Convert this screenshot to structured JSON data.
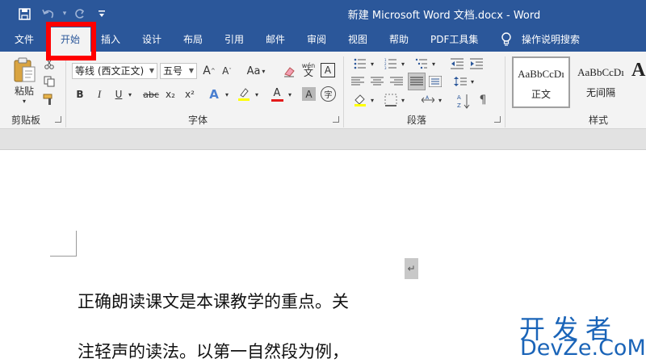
{
  "window": {
    "title": "新建 Microsoft Word 文档.docx  -  Word"
  },
  "quick_access": {
    "save_icon": "save-icon",
    "undo_icon": "undo-icon",
    "redo_icon": "redo-icon",
    "customize_icon": "customize-quick-access-icon"
  },
  "menu": {
    "tabs": [
      {
        "label": "文件"
      },
      {
        "label": "开始"
      },
      {
        "label": "插入"
      },
      {
        "label": "设计"
      },
      {
        "label": "布局"
      },
      {
        "label": "引用"
      },
      {
        "label": "邮件"
      },
      {
        "label": "审阅"
      },
      {
        "label": "视图"
      },
      {
        "label": "帮助"
      },
      {
        "label": "PDF工具集"
      },
      {
        "label": "操作说明搜索"
      }
    ],
    "active_tab": "开始",
    "highlight_color": "#ff0000"
  },
  "ribbon": {
    "clipboard": {
      "label": "剪贴板",
      "paste_label": "粘贴"
    },
    "font": {
      "label": "字体",
      "font_name": "等线 (西文正文)",
      "font_size": "五号",
      "grow_label": "A",
      "shrink_label": "A",
      "case_label": "Aa",
      "phonetic_label": "wén",
      "border_label": "A",
      "bold": "B",
      "italic": "I",
      "underline": "U",
      "strike": "abc",
      "subscript": "x₂",
      "superscript": "x²",
      "text_effect": "A",
      "font_color": "A",
      "shading": "A",
      "enclose": "字"
    },
    "paragraph": {
      "label": "段落"
    },
    "styles": {
      "label": "样式",
      "items": [
        {
          "sample": "AaBbCcDı",
          "name": "正文"
        },
        {
          "sample": "AaBbCcDı",
          "name": "无间隔"
        },
        {
          "sample": "A",
          "name": ""
        }
      ]
    }
  },
  "document": {
    "paragraph_mark": "↵",
    "lines": [
      "正确朗读课文是本课教学的重点。关",
      "注轻声的读法。以第一自然段为例，"
    ]
  },
  "watermark": {
    "chinese": "开发者",
    "english": "DevZe.CoM",
    "color": "#1a64b8"
  },
  "colors": {
    "accent": "#2b579a",
    "font_color_bar": "#e31b1b",
    "highlight_bar": "#ffff00"
  }
}
